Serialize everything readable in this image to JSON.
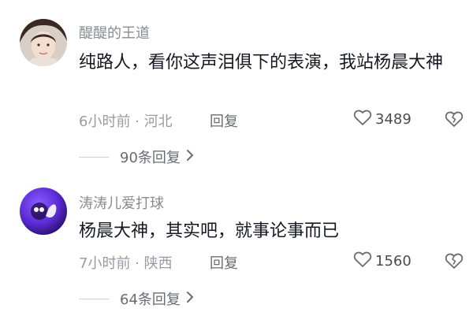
{
  "comments": [
    {
      "username": "醍醍的王道",
      "text": "纯路人，看你这声泪俱下的表演，我站杨晨大神",
      "time_location": "6小时前 · 河北",
      "reply_label": "回复",
      "likes": "3489",
      "replies_label": "90条回复"
    },
    {
      "username": "涛涛儿爱打球",
      "text": "杨晨大神，其实吧，就事论事而已",
      "time_location": "7小时前 · 陕西",
      "reply_label": "回复",
      "likes": "1560",
      "replies_label": "64条回复"
    }
  ],
  "colors": {
    "username": "#8a8b91",
    "meta": "#9a9ba1",
    "text": "#161823",
    "avatar2": "#5b2bd6"
  },
  "icons": [
    "heart-icon",
    "broken-heart-icon",
    "chevron-right-icon"
  ]
}
